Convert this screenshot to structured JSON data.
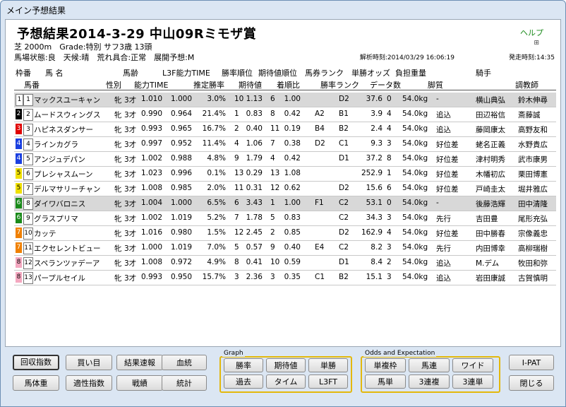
{
  "window_title": "メイン予想結果",
  "header": {
    "title": "予想結果2014-3-29 中山09Rミモザ賞",
    "help": "ヘルプ",
    "course": "芝 2000m　Grade:特別 サフ3歳 13頭",
    "conditions": "馬場状態:良　天候:晴　荒れ具合:正常　展開予想:M",
    "analysis_time": "解析時刻:2014/03/29 16:06:19",
    "start_time": "発走時刻:14:35"
  },
  "columns_top": [
    "枠番",
    "馬 名",
    "馬齢",
    "L3F能力TIME",
    "勝率順位",
    "期待値順位",
    "馬券ランク",
    "単勝オッズ",
    "負担重量",
    "騎手"
  ],
  "columns_bottom": [
    "馬番",
    "性別",
    "能力TIME",
    "推定勝率",
    "期待値",
    "着順比",
    "勝率ランク",
    "データ数",
    "脚質",
    "調教師"
  ],
  "rows": [
    {
      "waku": "1",
      "uma": "1",
      "name": "マックスユーキャン",
      "sex": "牝",
      "age": "3才",
      "ability": "1.010",
      "l3f": "1.000",
      "winrate": "3.0%",
      "wrank": "10",
      "ev": "1.13",
      "evrank": "6",
      "ratio": "1.00",
      "ticket": "",
      "rank": "D2",
      "odds": "37.6",
      "data": "0",
      "weight": "54.0kg",
      "style": "-",
      "jockey": "横山典弘",
      "trainer": "鈴木伸尋"
    },
    {
      "waku": "2",
      "uma": "2",
      "name": "ムードスウィングス",
      "sex": "牝",
      "age": "3才",
      "ability": "0.990",
      "l3f": "0.964",
      "winrate": "21.4%",
      "wrank": "1",
      "ev": "0.83",
      "evrank": "8",
      "ratio": "0.42",
      "ticket": "A2",
      "rank": "B1",
      "odds": "3.9",
      "data": "4",
      "weight": "54.0kg",
      "style": "追込",
      "jockey": "田辺裕信",
      "trainer": "斎藤誠"
    },
    {
      "waku": "3",
      "uma": "3",
      "name": "ハピネスダンサー",
      "sex": "牝",
      "age": "3才",
      "ability": "0.993",
      "l3f": "0.965",
      "winrate": "16.7%",
      "wrank": "2",
      "ev": "0.40",
      "evrank": "11",
      "ratio": "0.19",
      "ticket": "B4",
      "rank": "B2",
      "odds": "2.4",
      "data": "4",
      "weight": "54.0kg",
      "style": "追込",
      "jockey": "藤岡康太",
      "trainer": "高野友和"
    },
    {
      "waku": "4",
      "uma": "4",
      "name": "ラインカグラ",
      "sex": "牝",
      "age": "3才",
      "ability": "0.997",
      "l3f": "0.952",
      "winrate": "11.4%",
      "wrank": "4",
      "ev": "1.06",
      "evrank": "7",
      "ratio": "0.38",
      "ticket": "D2",
      "rank": "C1",
      "odds": "9.3",
      "data": "3",
      "weight": "54.0kg",
      "style": "好位差",
      "jockey": "蛯名正義",
      "trainer": "水野貴広"
    },
    {
      "waku": "4",
      "uma": "5",
      "name": "アンジュデパン",
      "sex": "牝",
      "age": "3才",
      "ability": "1.002",
      "l3f": "0.988",
      "winrate": "4.8%",
      "wrank": "9",
      "ev": "1.79",
      "evrank": "4",
      "ratio": "0.42",
      "ticket": "",
      "rank": "D1",
      "odds": "37.2",
      "data": "8",
      "weight": "54.0kg",
      "style": "好位差",
      "jockey": "津村明秀",
      "trainer": "武市康男"
    },
    {
      "waku": "5",
      "uma": "6",
      "name": "プレシャスムーン",
      "sex": "牝",
      "age": "3才",
      "ability": "1.023",
      "l3f": "0.996",
      "winrate": "0.1%",
      "wrank": "13",
      "ev": "0.29",
      "evrank": "13",
      "ratio": "1.08",
      "ticket": "",
      "rank": "",
      "odds": "252.9",
      "data": "1",
      "weight": "54.0kg",
      "style": "好位差",
      "jockey": "木幡初広",
      "trainer": "栗田博憲"
    },
    {
      "waku": "5",
      "uma": "7",
      "name": "デルマサリーチャン",
      "sex": "牝",
      "age": "3才",
      "ability": "1.008",
      "l3f": "0.985",
      "winrate": "2.0%",
      "wrank": "11",
      "ev": "0.31",
      "evrank": "12",
      "ratio": "0.62",
      "ticket": "",
      "rank": "D2",
      "odds": "15.6",
      "data": "6",
      "weight": "54.0kg",
      "style": "好位差",
      "jockey": "戸崎圭太",
      "trainer": "堀井雅広"
    },
    {
      "waku": "6",
      "uma": "8",
      "name": "ダイワバロニス",
      "sex": "牝",
      "age": "3才",
      "ability": "1.004",
      "l3f": "1.000",
      "winrate": "6.5%",
      "wrank": "6",
      "ev": "3.43",
      "evrank": "1",
      "ratio": "1.00",
      "ticket": "F1",
      "rank": "C2",
      "odds": "53.1",
      "data": "0",
      "weight": "54.0kg",
      "style": "-",
      "jockey": "後藤浩輝",
      "trainer": "田中清隆"
    },
    {
      "waku": "6",
      "uma": "9",
      "name": "グラスプリマ",
      "sex": "牝",
      "age": "3才",
      "ability": "1.002",
      "l3f": "1.019",
      "winrate": "5.2%",
      "wrank": "7",
      "ev": "1.78",
      "evrank": "5",
      "ratio": "0.83",
      "ticket": "",
      "rank": "C2",
      "odds": "34.3",
      "data": "3",
      "weight": "54.0kg",
      "style": "先行",
      "jockey": "吉田豊",
      "trainer": "尾形充弘"
    },
    {
      "waku": "7",
      "uma": "10",
      "name": "カッテ",
      "sex": "牝",
      "age": "3才",
      "ability": "1.016",
      "l3f": "0.980",
      "winrate": "1.5%",
      "wrank": "12",
      "ev": "2.45",
      "evrank": "2",
      "ratio": "0.85",
      "ticket": "",
      "rank": "D2",
      "odds": "162.9",
      "data": "4",
      "weight": "54.0kg",
      "style": "好位差",
      "jockey": "田中勝春",
      "trainer": "宗像義忠"
    },
    {
      "waku": "7",
      "uma": "11",
      "name": "エクセレントビュー",
      "sex": "牝",
      "age": "3才",
      "ability": "1.000",
      "l3f": "1.019",
      "winrate": "7.0%",
      "wrank": "5",
      "ev": "0.57",
      "evrank": "9",
      "ratio": "0.40",
      "ticket": "E4",
      "rank": "C2",
      "odds": "8.2",
      "data": "3",
      "weight": "54.0kg",
      "style": "先行",
      "jockey": "内田博幸",
      "trainer": "高柳瑞樹"
    },
    {
      "waku": "8",
      "uma": "12",
      "name": "スペランツァデーア",
      "sex": "牝",
      "age": "3才",
      "ability": "1.008",
      "l3f": "0.972",
      "winrate": "4.9%",
      "wrank": "8",
      "ev": "0.41",
      "evrank": "10",
      "ratio": "0.59",
      "ticket": "",
      "rank": "D1",
      "odds": "8.4",
      "data": "2",
      "weight": "54.0kg",
      "style": "追込",
      "jockey": "M.デム",
      "trainer": "牧田和弥"
    },
    {
      "waku": "8",
      "uma": "13",
      "name": "パープルセイル",
      "sex": "牝",
      "age": "3才",
      "ability": "0.993",
      "l3f": "0.950",
      "winrate": "15.7%",
      "wrank": "3",
      "ev": "2.36",
      "evrank": "3",
      "ratio": "0.35",
      "ticket": "C1",
      "rank": "B2",
      "odds": "15.1",
      "data": "3",
      "weight": "54.0kg",
      "style": "追込",
      "jockey": "岩田康誠",
      "trainer": "古賀慎明"
    }
  ],
  "waku_colors": {
    "1": "#ffffff",
    "2": "#000000",
    "3": "#e00000",
    "4": "#1a3fe0",
    "5": "#f0e000",
    "6": "#1a8a1a",
    "7": "#f08000",
    "8": "#f4a8c0"
  },
  "buttons_left": [
    "回収指数",
    "買い目",
    "結果速報",
    "血統",
    "馬体重",
    "適性指数",
    "戦績",
    "統計"
  ],
  "graph": {
    "label": "Graph",
    "buttons": [
      "勝率",
      "期待値",
      "単勝",
      "過去",
      "タイム",
      "L3FT"
    ]
  },
  "odds": {
    "label": "Odds and Expectation",
    "buttons": [
      "単複枠",
      "馬連",
      "ワイド",
      "馬単",
      "3連複",
      "3連単"
    ]
  },
  "ipat": "I-PAT",
  "close": "閉じる",
  "accent": "#e3b80d"
}
